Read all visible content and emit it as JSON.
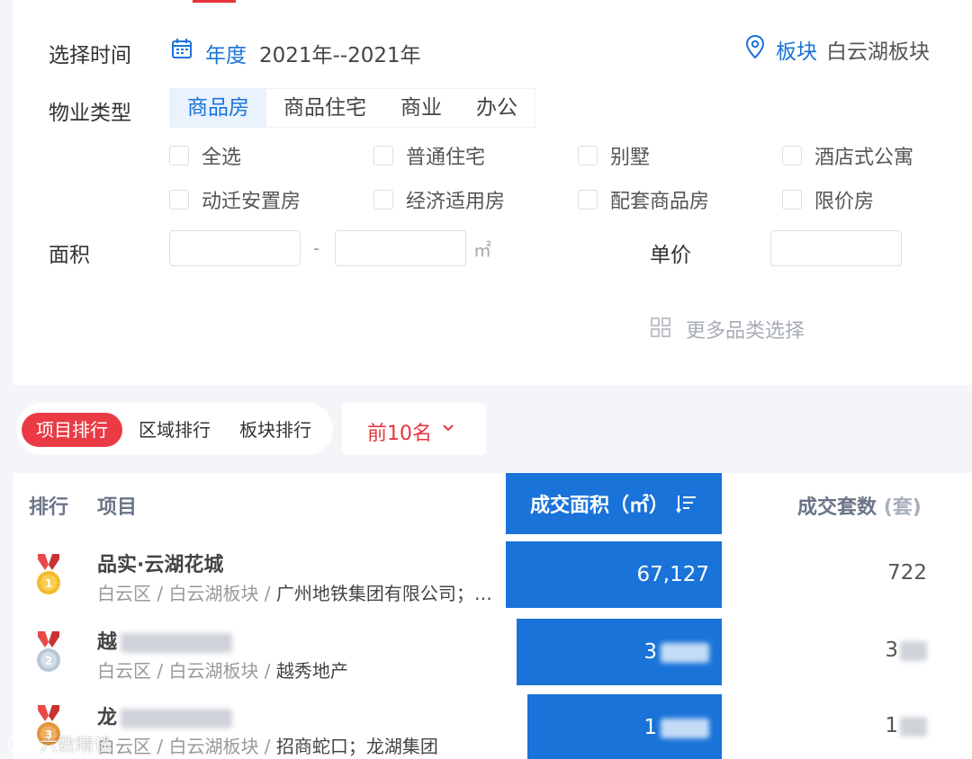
{
  "filters": {
    "time_label": "选择时间",
    "year_label": "年度",
    "year_value": "2021年--2021年",
    "block_label": "板块",
    "block_value": "白云湖板块",
    "property_type_label": "物业类型",
    "property_tabs": [
      "商品房",
      "商品住宅",
      "商业",
      "办公"
    ],
    "active_property_tab": "商品房",
    "subtypes": [
      "全选",
      "普通住宅",
      "别墅",
      "酒店式公寓",
      "动迁安置房",
      "经济适用房",
      "配套商品房",
      "限价房"
    ],
    "area_label": "面积",
    "area_dash": "-",
    "area_unit": "㎡",
    "price_label": "单价",
    "more_label": "更多品类选择"
  },
  "ranking": {
    "tabs": [
      "项目排行",
      "区域排行",
      "板块排行"
    ],
    "active_tab": "项目排行",
    "topn_label": "前10名"
  },
  "table": {
    "col_rank": "排行",
    "col_project": "项目",
    "col_area": "成交面积（㎡）",
    "col_count": "成交套数",
    "col_count_unit": "(套)",
    "rows": [
      {
        "name": "品实·云湖花城",
        "district": "白云区 / 白云湖板块 / ",
        "developer": "广州地铁集团有限公司；…",
        "area": "67,127",
        "count": "722",
        "medal": "gold-medal"
      },
      {
        "name": "越",
        "district": "白云区 / 白云湖板块 / ",
        "developer": "越秀地产",
        "area": "3",
        "count": "3",
        "medal": "silver-medal"
      },
      {
        "name": "龙",
        "district": "白云区 / 白云湖板块 / ",
        "developer": "招商蛇口；龙湖集团",
        "area": "1",
        "count": "1",
        "medal": "bronze-medal"
      }
    ]
  },
  "watermark": "六数晴谈",
  "colors": {
    "accent": "#1a73d9",
    "danger": "#ea3b45"
  }
}
